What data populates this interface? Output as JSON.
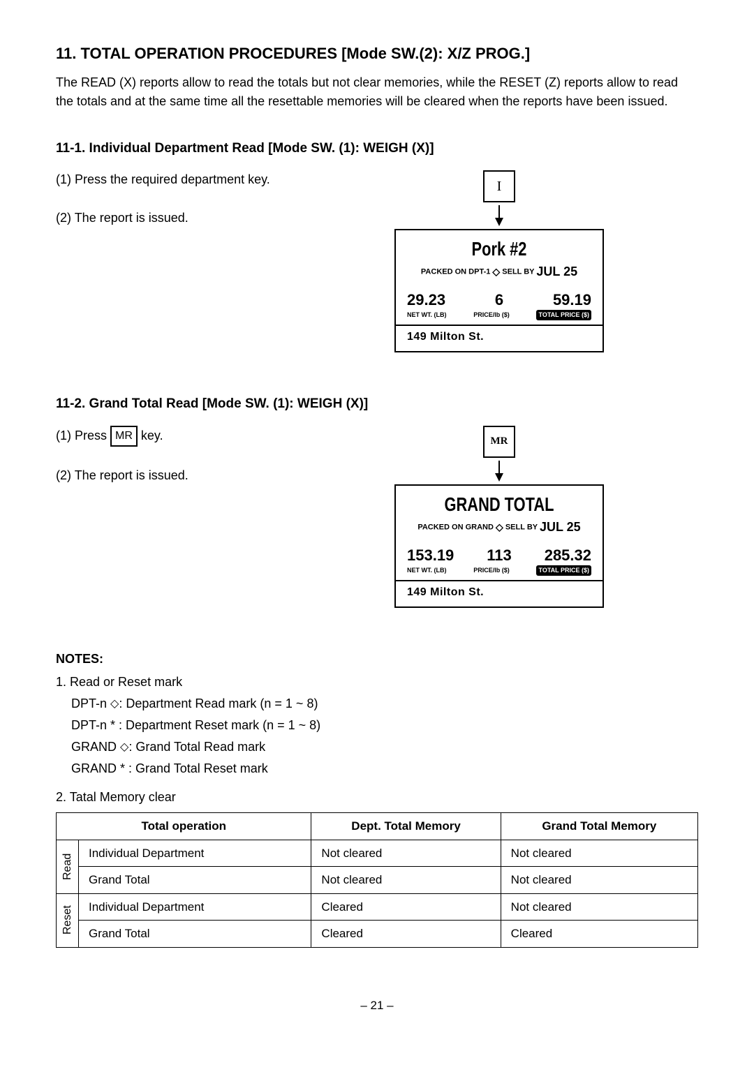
{
  "heading_main": "11. TOTAL OPERATION PROCEDURES [Mode SW.(2): X/Z PROG.]",
  "intro_text": "The READ (X) reports allow to read the totals but not clear memories, while the RESET (Z) reports allow to read the totals and at the same time all the resettable memories will be cleared when the reports have been issued.",
  "sec_11_1": {
    "heading": "11-1. Individual Department Read [Mode SW. (1): WEIGH (X)]",
    "step1_label": "(1) ",
    "step1_text": "Press the required department key.",
    "step2_label": "(2) ",
    "step2_text": "The report is issued.",
    "key_label": "I",
    "receipt": {
      "title": "Pork #2",
      "sub_left": "PACKED ON",
      "sub_dept": "DPT-1",
      "sub_mid": "SELL BY",
      "sub_date": "JUL 25",
      "val_weight": "29.23",
      "val_count": "6",
      "val_price": "59.19",
      "lbl_weight": "NET WT. (LB)",
      "lbl_count": "PRICE/lb ($)",
      "lbl_price": "TOTAL PRICE ($)",
      "addr": "149 Milton St."
    }
  },
  "sec_11_2": {
    "heading": "11-2. Grand Total Read [Mode SW. (1): WEIGH (X)]",
    "step1_label": "(1) ",
    "step1_text_pre": "Press ",
    "step1_key": "MR",
    "step1_text_post": " key.",
    "step2_label": "(2) ",
    "step2_text": "The report is issued.",
    "key_label": "MR",
    "receipt": {
      "title": "GRAND TOTAL",
      "sub_left": "PACKED ON",
      "sub_dept": "GRAND",
      "sub_mid": "SELL BY",
      "sub_date": "JUL 25",
      "val_weight": "153.19",
      "val_count": "113",
      "val_price": "285.32",
      "lbl_weight": "NET WT. (LB)",
      "lbl_count": "PRICE/lb ($)",
      "lbl_price": "TOTAL PRICE ($)",
      "addr": "149 Milton St."
    }
  },
  "notes": {
    "heading": "NOTES:",
    "n1": "1. Read or Reset mark",
    "n1a_pre": "DPT-n   ",
    "n1a_post": ": Department Read mark (n = 1 ~ 8)",
    "n1b": "DPT-n   * : Department Reset mark (n = 1 ~ 8)",
    "n1c_pre": "GRAND ",
    "n1c_post": ": Grand Total Read mark",
    "n1d": "GRAND * : Grand Total Reset mark",
    "n2": "2. Tatal Memory clear"
  },
  "table": {
    "hdr_op": "Total operation",
    "hdr_dept": "Dept. Total Memory",
    "hdr_grand": "Grand Total Memory",
    "vh_read": "Read",
    "vh_reset": "Reset",
    "rows": [
      {
        "op": "Individual Department",
        "dept": "Not cleared",
        "grand": "Not cleared"
      },
      {
        "op": "Grand Total",
        "dept": "Not cleared",
        "grand": "Not cleared"
      },
      {
        "op": "Individual Department",
        "dept": "Cleared",
        "grand": "Not cleared"
      },
      {
        "op": "Grand Total",
        "dept": "Cleared",
        "grand": "Cleared"
      }
    ]
  },
  "page_number": "– 21 –"
}
